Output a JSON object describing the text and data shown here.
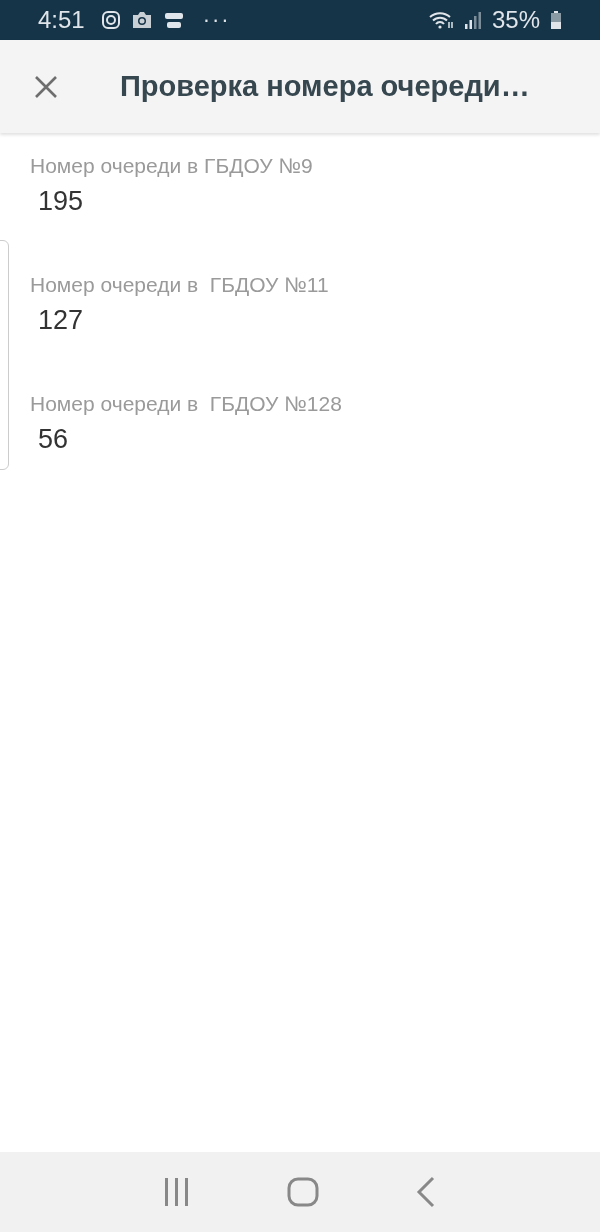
{
  "status_bar": {
    "time": "4:51",
    "notification_dots": "···",
    "battery": "35%"
  },
  "app_bar": {
    "title": "Проверка номера очереди…"
  },
  "items": [
    {
      "label": "Номер очереди в ГБДОУ №9",
      "value": "195"
    },
    {
      "label": "Номер очереди в  ГБДОУ №11",
      "value": "127"
    },
    {
      "label": "Номер очереди в  ГБДОУ №128",
      "value": "56"
    }
  ]
}
